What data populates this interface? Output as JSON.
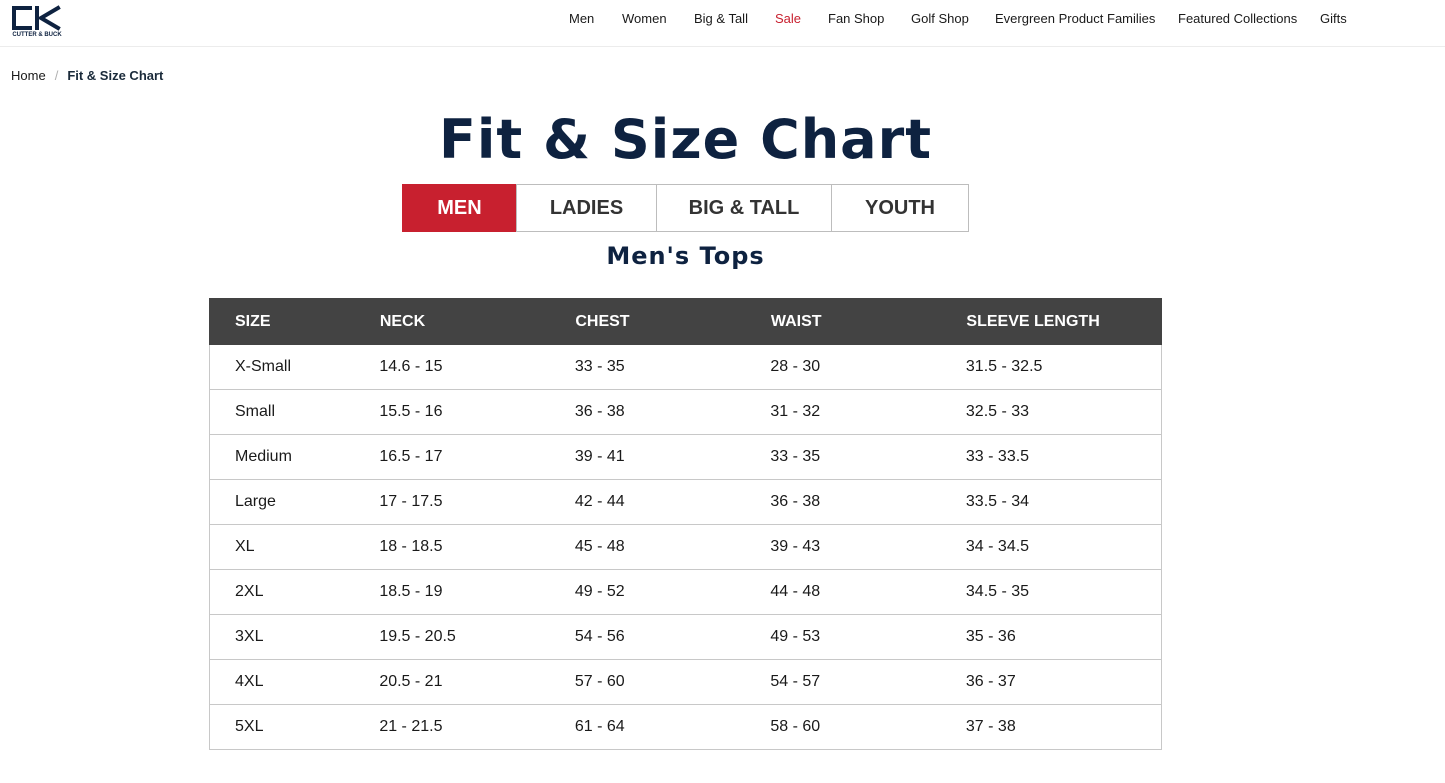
{
  "logo": {
    "text": "CUTTER & BUCK",
    "icon": "cutter-and-buck-logo-icon",
    "color": "#0e2240"
  },
  "nav": {
    "items": [
      {
        "label": "Men"
      },
      {
        "label": "Women"
      },
      {
        "label": "Big & Tall"
      },
      {
        "label": "Sale",
        "color": "#c8202f"
      },
      {
        "label": "Fan Shop"
      },
      {
        "label": "Golf Shop"
      },
      {
        "label": "Evergreen Product Families"
      },
      {
        "label": "Featured Collections"
      },
      {
        "label": "Gifts"
      }
    ]
  },
  "breadcrumb": {
    "home": "Home",
    "separator": "/",
    "current": "Fit & Size Chart"
  },
  "page": {
    "title": "Fit & Size Chart",
    "section_title": "Men's Tops"
  },
  "tabs": [
    {
      "label": "MEN",
      "active": true
    },
    {
      "label": "LADIES",
      "active": false
    },
    {
      "label": "BIG & TALL",
      "active": false
    },
    {
      "label": "YOUTH",
      "active": false
    }
  ],
  "colors": {
    "accent": "#c8202f",
    "navy": "#0e2240",
    "table_header": "#434343"
  },
  "table": {
    "headers": [
      "SIZE",
      "NECK",
      "CHEST",
      "WAIST",
      "SLEEVE LENGTH"
    ],
    "rows": [
      [
        "X-Small",
        "14.6 - 15",
        "33 - 35",
        "28 - 30",
        "31.5 - 32.5"
      ],
      [
        "Small",
        "15.5 - 16",
        "36 - 38",
        "31 - 32",
        "32.5 - 33"
      ],
      [
        "Medium",
        "16.5 - 17",
        "39 - 41",
        "33 - 35",
        "33 - 33.5"
      ],
      [
        "Large",
        "17 - 17.5",
        "42 - 44",
        "36 - 38",
        "33.5 - 34"
      ],
      [
        "XL",
        "18 - 18.5",
        "45 - 48",
        "39 - 43",
        "34 - 34.5"
      ],
      [
        "2XL",
        "18.5 - 19",
        "49 - 52",
        "44 - 48",
        "34.5 - 35"
      ],
      [
        "3XL",
        "19.5 - 20.5",
        "54 - 56",
        "49 - 53",
        "35 - 36"
      ],
      [
        "4XL",
        "20.5 - 21",
        "57 - 60",
        "54 - 57",
        "36 - 37"
      ],
      [
        "5XL",
        "21 - 21.5",
        "61 - 64",
        "58 - 60",
        "37 - 38"
      ]
    ]
  }
}
